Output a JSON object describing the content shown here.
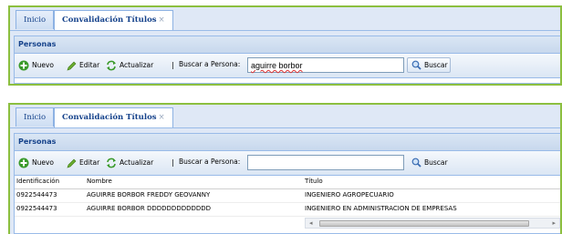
{
  "tabs": [
    {
      "label": "Inicio"
    },
    {
      "label": "Convalidación Títulos",
      "close": "×"
    }
  ],
  "panel_title": "Personas",
  "toolbar": {
    "nuevo": "Nuevo",
    "editar": "Editar",
    "actualizar": "Actualizar",
    "separator": "|",
    "search_label": "Buscar a Persona:",
    "search_button": "Buscar"
  },
  "search_top": {
    "value": "aguirre borbor"
  },
  "search_bottom": {
    "value": ""
  },
  "grid": {
    "columns": [
      "Identificación",
      "Nombre",
      "Título"
    ],
    "rows": [
      [
        "0922544473",
        "AGUIRRE BORBOR FREDDY GEOVANNY",
        "INGENIERO AGROPECUARIO"
      ],
      [
        "0922544473",
        "AGUIRRE BORBOR DDDDDDDDDDDDD",
        "INGENIERO EN ADMINISTRACION DE EMPRESAS"
      ]
    ]
  },
  "icons": {
    "nuevo": "add-icon",
    "editar": "pencil-icon",
    "actualizar": "refresh-icon",
    "buscar": "magnifier-icon"
  },
  "colors": {
    "frame": "#8cbf3f",
    "header_text": "#15428b",
    "pane_bg": "#dfe8f6"
  }
}
